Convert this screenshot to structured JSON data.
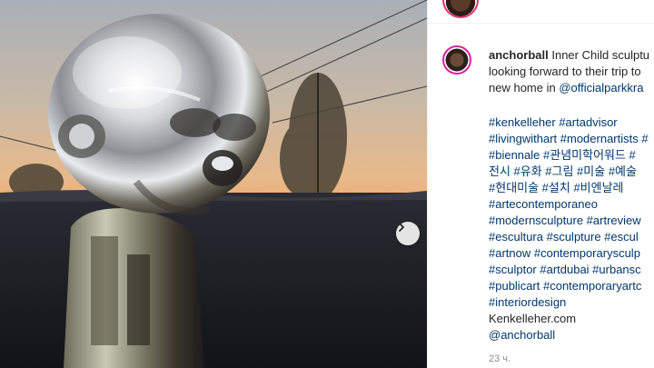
{
  "post": {
    "username": "anchorball",
    "caption_lines": [
      " Inner Child sculptu",
      "looking forward to their trip to",
      "new home in "
    ],
    "mention_link": "@officialparkkra",
    "tag_lines": [
      "#kenkelleher #artadvisor",
      "#livingwithart #modernartists #",
      "#biennale #관념미학어워드 #",
      "전시 #유화 #그림 #미술 #예술",
      "#현대미술 #설치 #비엔날레",
      "#artecontemporaneo",
      "#modernsculpture #artreview",
      "#escultura #sculpture #escul",
      "#artnow #contemporarysculp",
      "#sculptor #artdubai #urbansc",
      "#publicart #contemporaryartc",
      "#interiordesign"
    ],
    "website": "Kenkelleher.com",
    "user_mention": "@anchorball",
    "timestamp": "23 ч."
  },
  "icons": {
    "next": "chevron-right-icon"
  },
  "colors": {
    "link": "#00376b",
    "text": "#262626",
    "muted": "#8e8e8e",
    "story_ring": "#d6249f"
  }
}
